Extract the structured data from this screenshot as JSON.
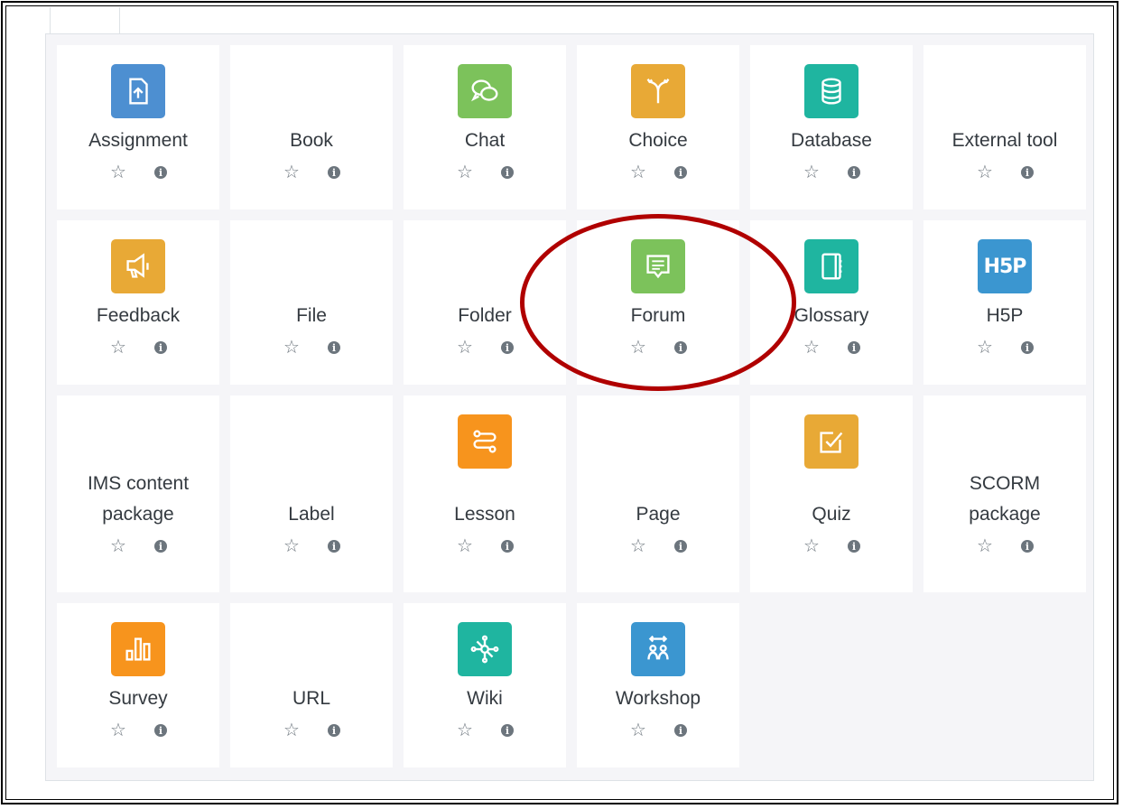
{
  "activities": [
    {
      "name": "Assignment",
      "icon": "assignment-icon",
      "color": "#4d8fd1"
    },
    {
      "name": "Book",
      "icon": "",
      "color": ""
    },
    {
      "name": "Chat",
      "icon": "chat-icon",
      "color": "#7cc25b"
    },
    {
      "name": "Choice",
      "icon": "choice-icon",
      "color": "#e8a936"
    },
    {
      "name": "Database",
      "icon": "database-icon",
      "color": "#1fb5a0"
    },
    {
      "name": "External tool",
      "icon": "",
      "color": ""
    },
    {
      "name": "Feedback",
      "icon": "feedback-icon",
      "color": "#e8a936"
    },
    {
      "name": "File",
      "icon": "",
      "color": ""
    },
    {
      "name": "Folder",
      "icon": "",
      "color": ""
    },
    {
      "name": "Forum",
      "icon": "forum-icon",
      "color": "#7cc25b"
    },
    {
      "name": "Glossary",
      "icon": "glossary-icon",
      "color": "#1fb5a0"
    },
    {
      "name": "H5P",
      "icon": "h5p-icon",
      "color": "#3b96d0"
    },
    {
      "name": "IMS content package",
      "icon": "",
      "color": ""
    },
    {
      "name": "Label",
      "icon": "",
      "color": ""
    },
    {
      "name": "Lesson",
      "icon": "lesson-icon",
      "color": "#f7941d"
    },
    {
      "name": "Page",
      "icon": "",
      "color": ""
    },
    {
      "name": "Quiz",
      "icon": "quiz-icon",
      "color": "#e8a936"
    },
    {
      "name": "SCORM package",
      "icon": "",
      "color": ""
    },
    {
      "name": "Survey",
      "icon": "survey-icon",
      "color": "#f7941d"
    },
    {
      "name": "URL",
      "icon": "",
      "color": ""
    },
    {
      "name": "Wiki",
      "icon": "wiki-icon",
      "color": "#1fb5a0"
    },
    {
      "name": "Workshop",
      "icon": "workshop-icon",
      "color": "#3b96d0"
    }
  ],
  "names": {
    "a0": "Assignment",
    "a1": "Book",
    "a2": "Chat",
    "a3": "Choice",
    "a4": "Database",
    "a5": "External tool",
    "a6": "Feedback",
    "a7": "File",
    "a8": "Folder",
    "a9": "Forum",
    "a10": "Glossary",
    "a11": "H5P",
    "a12_line1": "IMS content",
    "a12_line2": "package",
    "a13": "Label",
    "a14": "Lesson",
    "a15": "Page",
    "a16": "Quiz",
    "a17_line1": "SCORM",
    "a17_line2": "package",
    "a18": "Survey",
    "a19": "URL",
    "a20": "Wiki",
    "a21": "Workshop",
    "h5p_text": "H5P"
  },
  "glyphs": {
    "star": "☆",
    "info": "i"
  }
}
